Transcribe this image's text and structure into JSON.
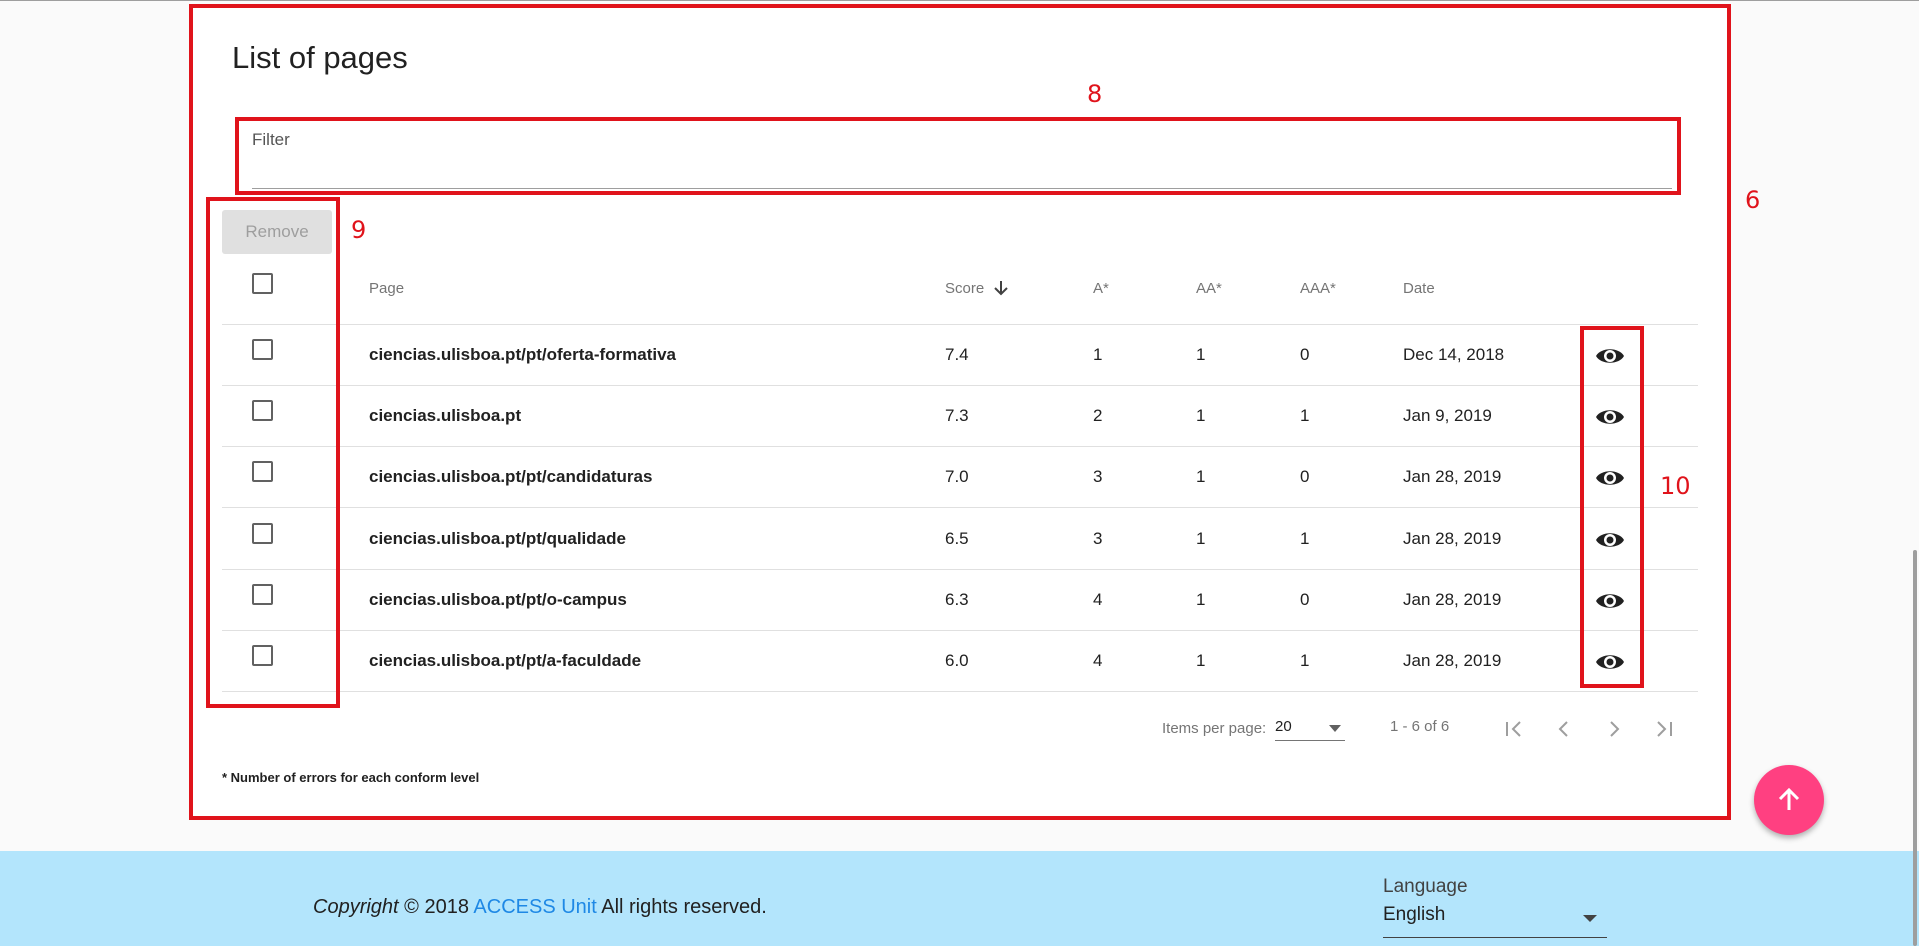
{
  "card": {
    "title": "List of pages",
    "filter": {
      "label": "Filter",
      "value": ""
    },
    "remove_label": "Remove",
    "columns": [
      "Page",
      "Score",
      "A*",
      "AA*",
      "AAA*",
      "Date"
    ],
    "rows": [
      {
        "page": "ciencias.ulisboa.pt/pt/oferta-formativa",
        "score": "7.4",
        "a": "1",
        "aa": "1",
        "aaa": "0",
        "date": "Dec 14, 2018"
      },
      {
        "page": "ciencias.ulisboa.pt",
        "score": "7.3",
        "a": "2",
        "aa": "1",
        "aaa": "1",
        "date": "Jan 9, 2019"
      },
      {
        "page": "ciencias.ulisboa.pt/pt/candidaturas",
        "score": "7.0",
        "a": "3",
        "aa": "1",
        "aaa": "0",
        "date": "Jan 28, 2019"
      },
      {
        "page": "ciencias.ulisboa.pt/pt/qualidade",
        "score": "6.5",
        "a": "3",
        "aa": "1",
        "aaa": "1",
        "date": "Jan 28, 2019"
      },
      {
        "page": "ciencias.ulisboa.pt/pt/o-campus",
        "score": "6.3",
        "a": "4",
        "aa": "1",
        "aaa": "0",
        "date": "Jan 28, 2019"
      },
      {
        "page": "ciencias.ulisboa.pt/pt/a-faculdade",
        "score": "6.0",
        "a": "4",
        "aa": "1",
        "aaa": "1",
        "date": "Jan 28, 2019"
      }
    ],
    "paginator": {
      "items_per_page_label": "Items per page:",
      "items_per_page_value": "20",
      "range_label": "1 - 6 of 6"
    },
    "footnote": "* Number of errors for each conform level"
  },
  "annotations": {
    "filter": "8",
    "card": "6",
    "checkboxes": "9",
    "view_icons": "10"
  },
  "footer": {
    "copyright_word": "Copyright",
    "copyright_text": " © 2018 ",
    "link_text": "ACCESS Unit",
    "suffix": " All rights reserved.",
    "language_label": "Language",
    "language_value": "English"
  },
  "colors": {
    "annotation_red": "#e0131b",
    "fab_pink": "#ff4081",
    "footer_blue": "#b3e5fc",
    "link_blue": "#1e88e5"
  },
  "icons": [
    "arrow-down-icon",
    "eye-icon",
    "first-page-icon",
    "chevron-left-icon",
    "chevron-right-icon",
    "last-page-icon",
    "arrow-up-icon",
    "dropdown-arrow-icon"
  ]
}
